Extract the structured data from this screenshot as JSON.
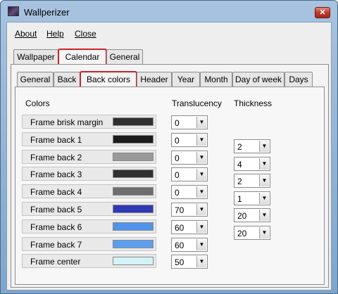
{
  "window": {
    "title": "Wallperizer",
    "close_glyph": "✕",
    "icon": "wallpaper-app-icon"
  },
  "menu": {
    "items": [
      "About",
      "Help",
      "Close"
    ]
  },
  "outer_tabs": [
    "Wallpaper",
    "Calendar",
    "General"
  ],
  "outer_active": "Calendar",
  "inner_tabs": [
    "General",
    "Back",
    "Back colors",
    "Header",
    "Year",
    "Month",
    "Day of week",
    "Days"
  ],
  "inner_active": "Back colors",
  "headers": {
    "colors": "Colors",
    "translucency": "Translucency",
    "thickness": "Thickness"
  },
  "colors": [
    {
      "label": "Frame brisk margin",
      "color": "#2f2f2f",
      "translucency": "0"
    },
    {
      "label": "Frame back 1",
      "color": "#1c1c1c",
      "translucency": "0"
    },
    {
      "label": "Frame back 2",
      "color": "#9a9a9a",
      "translucency": "0"
    },
    {
      "label": "Frame back 3",
      "color": "#303030",
      "translucency": "0"
    },
    {
      "label": "Frame back 4",
      "color": "#6e6e6e",
      "translucency": "0"
    },
    {
      "label": "Frame back 5",
      "color": "#2d39b5",
      "translucency": "70"
    },
    {
      "label": "Frame back 6",
      "color": "#4f93ec",
      "translucency": "60"
    },
    {
      "label": "Frame back 7",
      "color": "#5b9eef",
      "translucency": "60"
    },
    {
      "label": "Frame center",
      "color": "#d4f3f6",
      "translucency": "50"
    }
  ],
  "thickness": [
    "2",
    "4",
    "2",
    "1",
    "20",
    "20"
  ],
  "dropdown_glyph": "▼"
}
